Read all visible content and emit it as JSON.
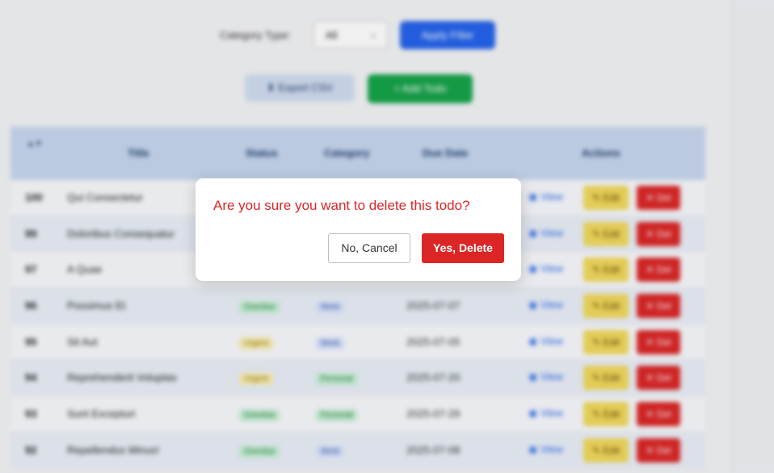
{
  "filter": {
    "label": "Category Type:",
    "selected": "All",
    "apply_label": "Apply Filter"
  },
  "actions": {
    "export_label": "Export CSV",
    "add_label": "Add Todo"
  },
  "table": {
    "columns": {
      "sort": "▲▼",
      "title": "Title",
      "status": "Status",
      "category": "Category",
      "due": "Due Date",
      "actions": "Actions"
    },
    "row_actions": {
      "view": "View",
      "edit": "Edit",
      "delete": "Del"
    },
    "rows": [
      {
        "id": "100",
        "title": "Qui Consectetur",
        "status": "",
        "category": "",
        "due": ""
      },
      {
        "id": "99",
        "title": "Doloribus Consequatur",
        "status": "",
        "category": "",
        "due": ""
      },
      {
        "id": "97",
        "title": "A Quae",
        "status": "",
        "category": "",
        "due": ""
      },
      {
        "id": "96",
        "title": "Possimus Et",
        "status": "Overdue",
        "category": "Work",
        "due": "2025-07-07"
      },
      {
        "id": "95",
        "title": "Sit Aut",
        "status": "Urgent",
        "category": "Work",
        "due": "2025-07-05"
      },
      {
        "id": "94",
        "title": "Reprehenderit Voluptas",
        "status": "Urgent",
        "category": "Personal",
        "due": "2025-07-20"
      },
      {
        "id": "93",
        "title": "Sunt Excepturi",
        "status": "Overdue",
        "category": "Personal",
        "due": "2025-07-29"
      },
      {
        "id": "92",
        "title": "Repellendus Minus!",
        "status": "Overdue",
        "category": "Work",
        "due": "2025-07-08"
      }
    ]
  },
  "colors": {
    "danger": "#dc2626",
    "primary": "#2563eb",
    "success": "#16a34a",
    "warning": "#f2d95c"
  },
  "modal": {
    "message": "Are you sure you want to delete this todo?",
    "cancel_label": "No, Cancel",
    "confirm_label": "Yes, Delete"
  }
}
